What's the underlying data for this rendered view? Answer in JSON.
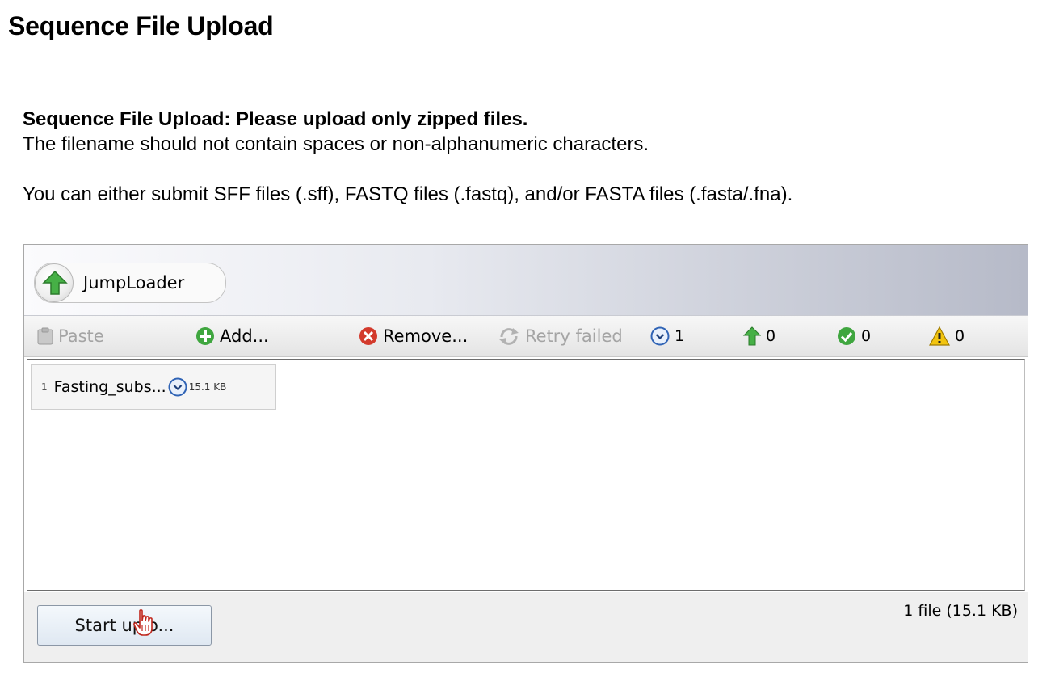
{
  "page": {
    "title": "Sequence File Upload"
  },
  "instructions": {
    "heading": "Sequence File Upload: Please upload only zipped files.",
    "line1": "The filename should not contain spaces or non-alphanumeric characters.",
    "line2": "You can either submit SFF files (.sff), FASTQ files (.fastq), and/or FASTA files (.fasta/.fna)."
  },
  "applet": {
    "brand": {
      "label": "JumpLoader",
      "icon": "green-up-arrow-icon"
    },
    "toolbar": {
      "paste": "Paste",
      "add": "Add...",
      "remove": "Remove...",
      "retry": "Retry failed",
      "counts": {
        "queued": "1",
        "uploading": "0",
        "done": "0",
        "failed": "0"
      }
    },
    "files": [
      {
        "index": "1",
        "name": "Fasting_subs...",
        "size": "15.1 KB",
        "status_icon": "pending-clock-icon"
      }
    ],
    "start_button": "Start uplo...",
    "summary": "1 file (15.1 KB)"
  },
  "colors": {
    "green": "#3fa63f",
    "red": "#d33a2c",
    "warning": "#f2c40f",
    "blue_icon": "#2f63b5"
  }
}
